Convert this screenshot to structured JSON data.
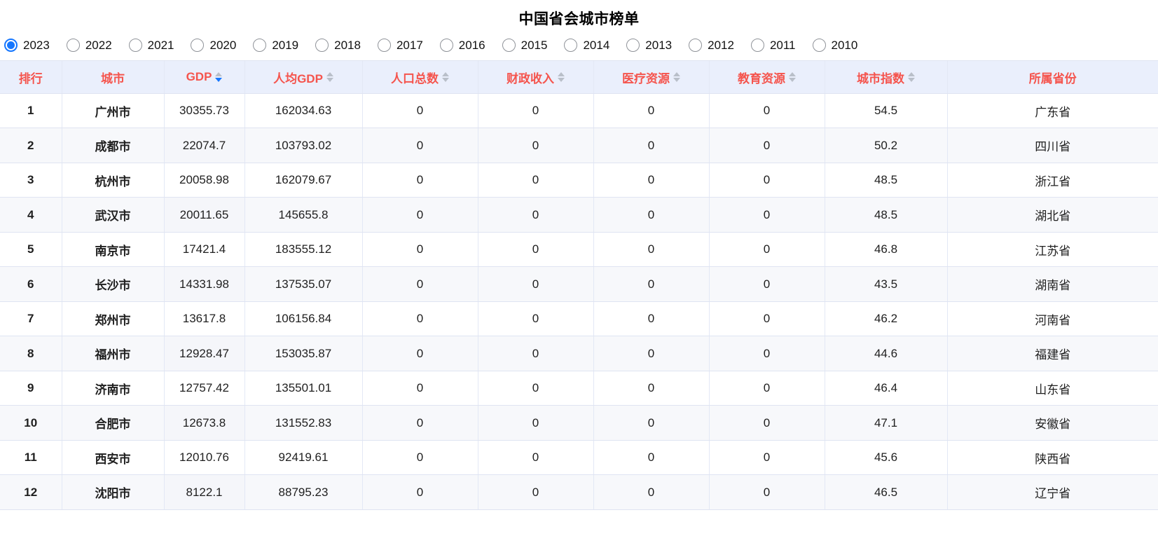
{
  "header": {
    "title": "中国省会城市榜单"
  },
  "year_filter": {
    "name": "year",
    "selected": "2023",
    "accent_color": "#1677ff",
    "options": [
      {
        "label": "2023",
        "selected": true
      },
      {
        "label": "2022",
        "selected": false
      },
      {
        "label": "2021",
        "selected": false
      },
      {
        "label": "2020",
        "selected": false
      },
      {
        "label": "2019",
        "selected": false
      },
      {
        "label": "2018",
        "selected": false
      },
      {
        "label": "2017",
        "selected": false
      },
      {
        "label": "2016",
        "selected": false
      },
      {
        "label": "2015",
        "selected": false
      },
      {
        "label": "2014",
        "selected": false
      },
      {
        "label": "2013",
        "selected": false
      },
      {
        "label": "2012",
        "selected": false
      },
      {
        "label": "2011",
        "selected": false
      },
      {
        "label": "2010",
        "selected": false
      }
    ]
  },
  "table": {
    "header_text_color": "#f5544d",
    "header_bg_color": "#eaeffc",
    "rank_color": "#e03a34",
    "city_color": "#4a6fc4",
    "columns": [
      {
        "key": "rank",
        "label": "排行",
        "sortable": false,
        "sort_state": "none"
      },
      {
        "key": "city",
        "label": "城市",
        "sortable": false,
        "sort_state": "none"
      },
      {
        "key": "gdp",
        "label": "GDP",
        "sortable": true,
        "sort_state": "desc"
      },
      {
        "key": "per_gdp",
        "label": "人均GDP",
        "sortable": true,
        "sort_state": "none"
      },
      {
        "key": "pop",
        "label": "人口总数",
        "sortable": true,
        "sort_state": "none"
      },
      {
        "key": "finance",
        "label": "财政收入",
        "sortable": true,
        "sort_state": "none"
      },
      {
        "key": "medical",
        "label": "医疗资源",
        "sortable": true,
        "sort_state": "none"
      },
      {
        "key": "edu",
        "label": "教育资源",
        "sortable": true,
        "sort_state": "none"
      },
      {
        "key": "index",
        "label": "城市指数",
        "sortable": true,
        "sort_state": "none"
      },
      {
        "key": "province",
        "label": "所属省份",
        "sortable": false,
        "sort_state": "none"
      }
    ],
    "rows": [
      {
        "rank": "1",
        "city": "广州市",
        "gdp": "30355.73",
        "per_gdp": "162034.63",
        "pop": "0",
        "finance": "0",
        "medical": "0",
        "edu": "0",
        "index": "54.5",
        "province": "广东省"
      },
      {
        "rank": "2",
        "city": "成都市",
        "gdp": "22074.7",
        "per_gdp": "103793.02",
        "pop": "0",
        "finance": "0",
        "medical": "0",
        "edu": "0",
        "index": "50.2",
        "province": "四川省"
      },
      {
        "rank": "3",
        "city": "杭州市",
        "gdp": "20058.98",
        "per_gdp": "162079.67",
        "pop": "0",
        "finance": "0",
        "medical": "0",
        "edu": "0",
        "index": "48.5",
        "province": "浙江省"
      },
      {
        "rank": "4",
        "city": "武汉市",
        "gdp": "20011.65",
        "per_gdp": "145655.8",
        "pop": "0",
        "finance": "0",
        "medical": "0",
        "edu": "0",
        "index": "48.5",
        "province": "湖北省"
      },
      {
        "rank": "5",
        "city": "南京市",
        "gdp": "17421.4",
        "per_gdp": "183555.12",
        "pop": "0",
        "finance": "0",
        "medical": "0",
        "edu": "0",
        "index": "46.8",
        "province": "江苏省"
      },
      {
        "rank": "6",
        "city": "长沙市",
        "gdp": "14331.98",
        "per_gdp": "137535.07",
        "pop": "0",
        "finance": "0",
        "medical": "0",
        "edu": "0",
        "index": "43.5",
        "province": "湖南省"
      },
      {
        "rank": "7",
        "city": "郑州市",
        "gdp": "13617.8",
        "per_gdp": "106156.84",
        "pop": "0",
        "finance": "0",
        "medical": "0",
        "edu": "0",
        "index": "46.2",
        "province": "河南省"
      },
      {
        "rank": "8",
        "city": "福州市",
        "gdp": "12928.47",
        "per_gdp": "153035.87",
        "pop": "0",
        "finance": "0",
        "medical": "0",
        "edu": "0",
        "index": "44.6",
        "province": "福建省"
      },
      {
        "rank": "9",
        "city": "济南市",
        "gdp": "12757.42",
        "per_gdp": "135501.01",
        "pop": "0",
        "finance": "0",
        "medical": "0",
        "edu": "0",
        "index": "46.4",
        "province": "山东省"
      },
      {
        "rank": "10",
        "city": "合肥市",
        "gdp": "12673.8",
        "per_gdp": "131552.83",
        "pop": "0",
        "finance": "0",
        "medical": "0",
        "edu": "0",
        "index": "47.1",
        "province": "安徽省"
      },
      {
        "rank": "11",
        "city": "西安市",
        "gdp": "12010.76",
        "per_gdp": "92419.61",
        "pop": "0",
        "finance": "0",
        "medical": "0",
        "edu": "0",
        "index": "45.6",
        "province": "陕西省"
      },
      {
        "rank": "12",
        "city": "沈阳市",
        "gdp": "8122.1",
        "per_gdp": "88795.23",
        "pop": "0",
        "finance": "0",
        "medical": "0",
        "edu": "0",
        "index": "46.5",
        "province": "辽宁省"
      }
    ]
  }
}
